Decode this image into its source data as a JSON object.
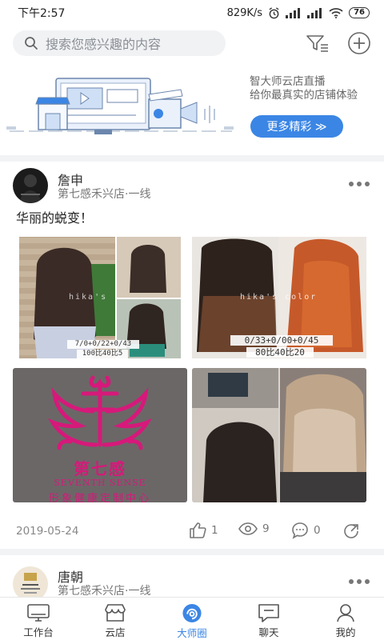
{
  "status_bar": {
    "time": "下午2:57",
    "speed": "829K/s",
    "battery": "76"
  },
  "search": {
    "placeholder": "搜索您感兴趣的内容"
  },
  "banner": {
    "line1": "智大师云店直播",
    "line2": "给你最真实的店铺体验",
    "button_label": "更多精彩 ≫"
  },
  "posts": [
    {
      "author": "詹申",
      "shop": "第七感禾兴店·一线",
      "text": "华丽的蜕变！",
      "photos": [
        {
          "watermark": "hika's",
          "caption_1": "7/0+0/22+0/43",
          "caption_2": "100比40比5"
        },
        {
          "watermark": "hika's color",
          "caption_1": "0/33+0/00+0/45",
          "caption_2": "80比40比20"
        },
        {
          "logo_text": "第七感",
          "logo_en": "SEVENTH SENSE",
          "logo_sub": "形象健康定制中心"
        },
        {}
      ],
      "date": "2019-05-24",
      "likes": "1",
      "views": "9",
      "comments": "0"
    },
    {
      "author": "唐朝",
      "shop": "第七感禾兴店·一线"
    }
  ],
  "nav": {
    "items": [
      {
        "label": "工作台",
        "icon": "monitor-icon"
      },
      {
        "label": "云店",
        "icon": "store-icon"
      },
      {
        "label": "大师圈",
        "icon": "circle-swirl-icon"
      },
      {
        "label": "聊天",
        "icon": "chat-icon"
      },
      {
        "label": "我的",
        "icon": "user-icon"
      }
    ],
    "active_index": 2
  },
  "colors": {
    "accent": "#3b86e5",
    "logo_pink": "#d6197a"
  }
}
